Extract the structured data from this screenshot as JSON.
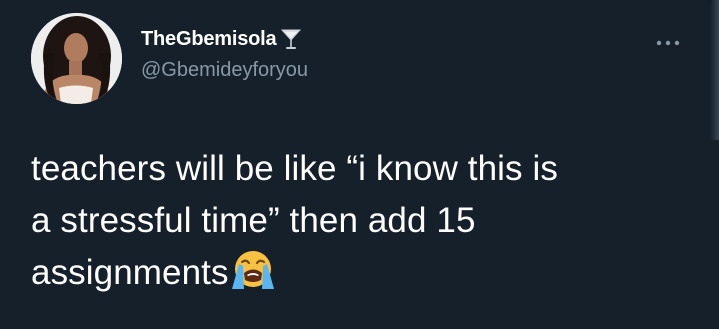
{
  "user": {
    "display_name": "TheGbemisola",
    "handle": "@Gbemideyforyou",
    "badge_icon": "cocktail-glass-icon",
    "avatar_icon": "profile-photo"
  },
  "tweet": {
    "lines": [
      "teachers will be like “i know this is",
      "a stressful time” then add 15",
      "assignments"
    ],
    "trailing_emoji": "loudly-crying-face-icon"
  },
  "menu": {
    "more_icon": "more-options-icon"
  },
  "colors": {
    "background": "#15202b",
    "primary_text": "#ffffff",
    "secondary_text": "#8899a6",
    "emoji_face": "#f7c241",
    "emoji_tears": "#5bb6f0"
  }
}
